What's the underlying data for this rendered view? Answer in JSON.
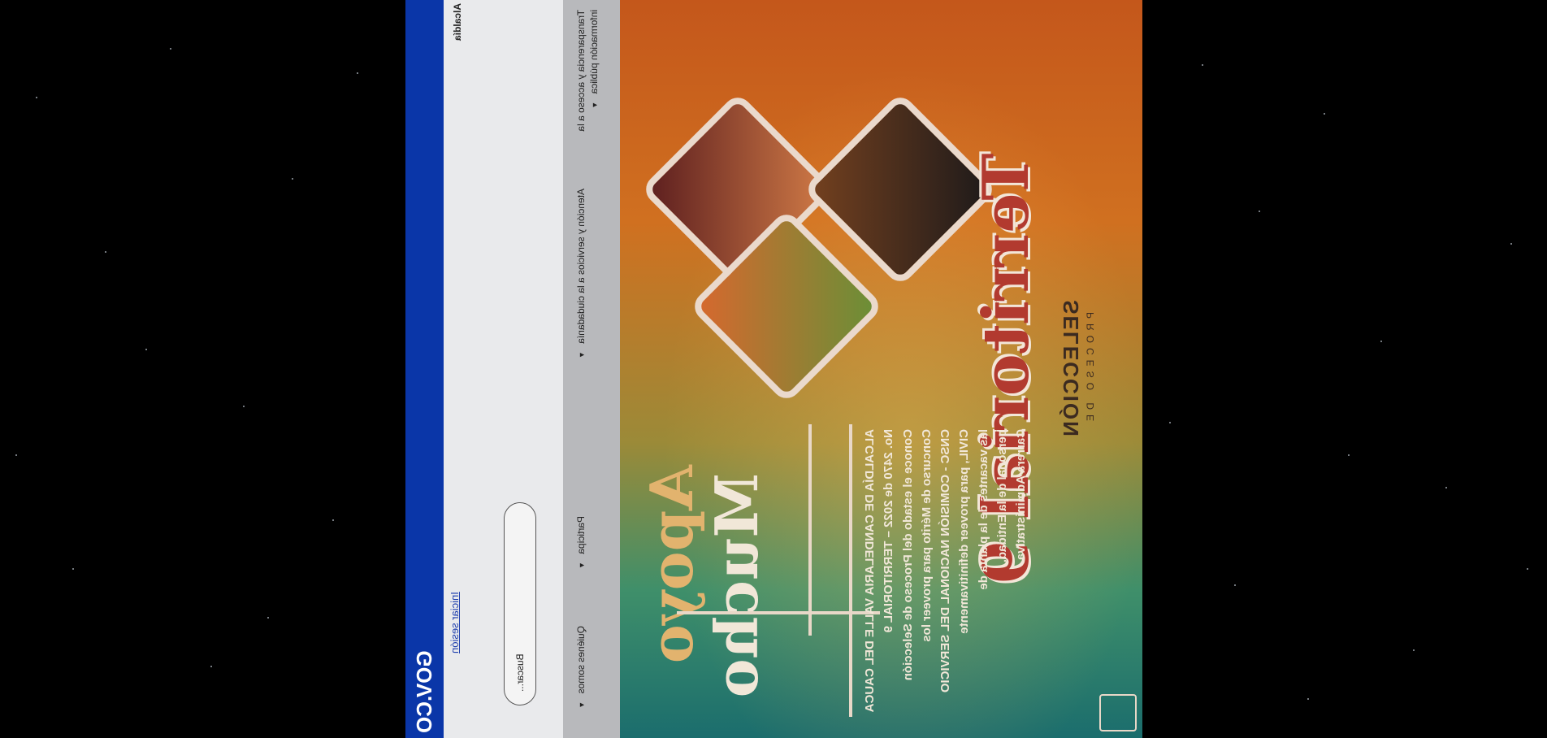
{
  "topbar": {
    "gov_label": "GOV.CO"
  },
  "header": {
    "login_link": "Iniciar sesión",
    "logo_text": "Alcaldía",
    "search_placeholder": "Buscar..."
  },
  "nav": {
    "items": [
      {
        "label": "Transparencia y acceso a la información pública"
      },
      {
        "label": "Atención y servicios a la ciudadanía"
      },
      {
        "label": "Participa"
      },
      {
        "label": "Quiénes somos"
      }
    ]
  },
  "banner": {
    "heading_big": "Territorial 9",
    "selection_label": "SELECCIÓN",
    "process_label": "PROCESO DE",
    "apoyo_line1": "Apoyo",
    "apoyo_line2": "Mucho",
    "copy_lines": [
      "ALCALDÍA DE CANDELARIA VALLE DEL CAUCA",
      "No. 2470 de 2022 – TERRITORIAL 9",
      "Conoce el estado del Proceso de Selección",
      "Concurso de Mérito para proveer los",
      "CNSC - COMISIÓN NACIONAL DEL SERVICIO",
      "CIVIL, para proveer definitivamente",
      "las vacantes de la planta de",
      "personal de la Entidad.",
      "Carrera Administrativa."
    ]
  },
  "colors": {
    "topbar": "#0a36a8",
    "header_bg": "#e9eaec",
    "nav_bg": "#b8b9bc",
    "banner_warm": "#c4571b",
    "banner_cool": "#1b6d6d",
    "title_red": "#b23a2f"
  }
}
